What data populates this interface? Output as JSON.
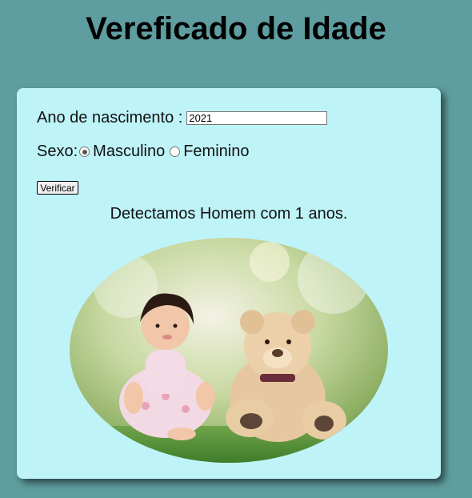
{
  "page": {
    "title": "Vereficado de Idade"
  },
  "form": {
    "birth_label": "Ano de nascimento :",
    "birth_value": "2021",
    "sex_label": "Sexo:",
    "sex_options": [
      {
        "label": "Masculino",
        "checked": true
      },
      {
        "label": "Feminino",
        "checked": false
      }
    ],
    "verify_button": "Verificar"
  },
  "result": {
    "text": "Detectamos Homem com 1 anos."
  },
  "colors": {
    "background": "#5f9ea0",
    "card": "#bef3f8"
  }
}
